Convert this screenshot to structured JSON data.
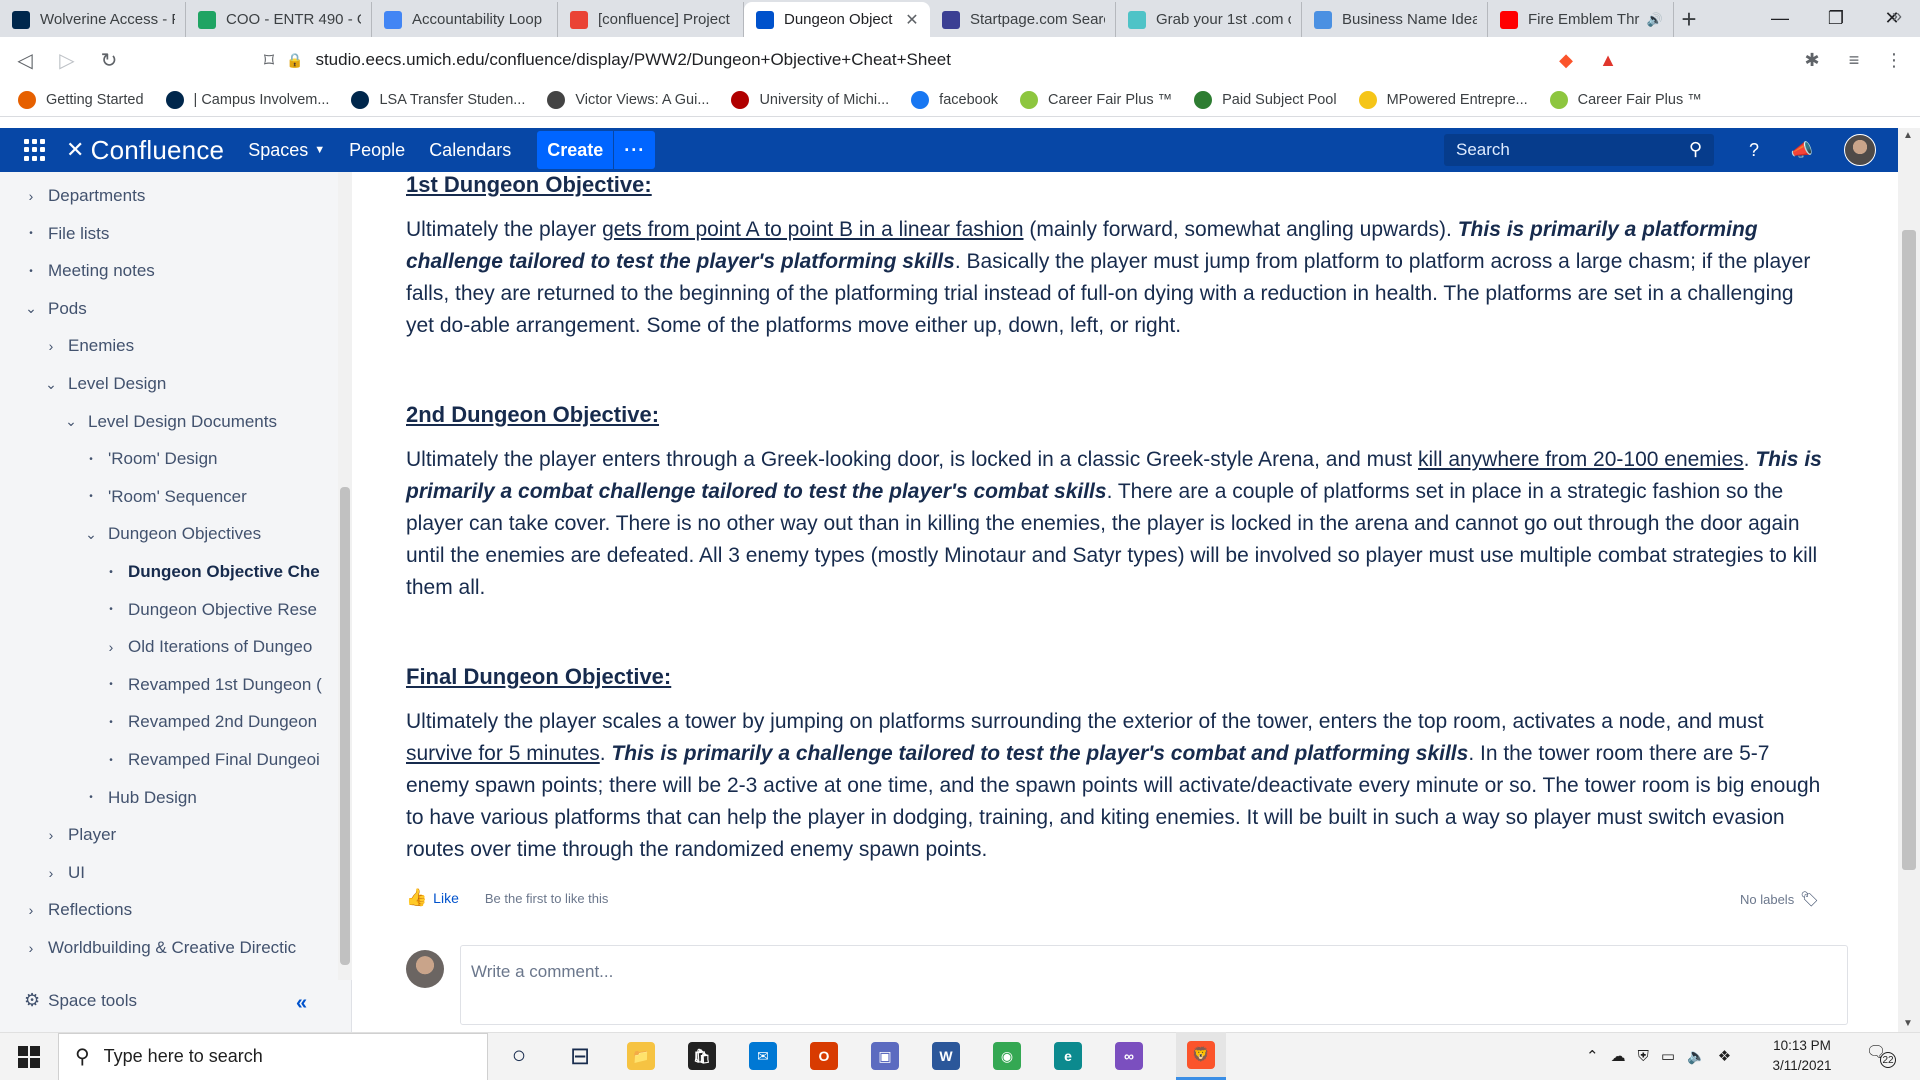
{
  "browser": {
    "tabs": [
      {
        "label": "Wolverine Access - F",
        "icon": "umich-block-m-icon",
        "color": "#00274c"
      },
      {
        "label": "COO - ENTR 490 - G",
        "icon": "google-drive-icon",
        "color": "#1fa463"
      },
      {
        "label": "Accountability Loop",
        "icon": "google-docs-icon",
        "color": "#4285f4"
      },
      {
        "label": "[confluence] Project",
        "icon": "gmail-icon",
        "color": "#ea4335"
      },
      {
        "label": "Dungeon Object",
        "icon": "confluence-icon",
        "color": "#0052cc",
        "active": true
      },
      {
        "label": "Startpage.com Searc",
        "icon": "startpage-icon",
        "color": "#3b3f93"
      },
      {
        "label": "Grab your 1st .com c",
        "icon": "domain-icon",
        "color": "#4fc3c7"
      },
      {
        "label": "Business Name Ideas",
        "icon": "bng-icon",
        "color": "#4a90e2"
      },
      {
        "label": "Fire Emblem Thr",
        "icon": "youtube-icon",
        "color": "#ff0000",
        "audio": true
      }
    ],
    "close_glyph": "✕",
    "new_tab_glyph": "+",
    "address": "studio.eecs.umich.edu/confluence/display/PWW2/Dungeon+Objective+Cheat+Sheet",
    "bookmarks": [
      {
        "label": "Getting Started",
        "icon": "firefox-icon",
        "color": "#e66000"
      },
      {
        "label": "| Campus Involvem...",
        "icon": "umich-block-m-icon",
        "color": "#00274c"
      },
      {
        "label": "LSA Transfer Studen...",
        "icon": "lsa-icon",
        "color": "#00274c"
      },
      {
        "label": "Victor Views: A Gui...",
        "icon": "globe-icon",
        "color": "#444444"
      },
      {
        "label": "University of Michi...",
        "icon": "umich-square-icon",
        "color": "#b00000"
      },
      {
        "label": "facebook",
        "icon": "facebook-icon",
        "color": "#1877f2"
      },
      {
        "label": "Career Fair Plus ™",
        "icon": "career-fair-icon",
        "color": "#8dc63f"
      },
      {
        "label": "Paid Subject Pool",
        "icon": "subject-pool-icon",
        "color": "#2e7d32"
      },
      {
        "label": "MPowered Entrepre...",
        "icon": "hexagon-icon",
        "color": "#f5c518"
      },
      {
        "label": "Career Fair Plus ™",
        "icon": "career-fair-icon",
        "color": "#8dc63f"
      }
    ]
  },
  "header": {
    "logo": "Confluence",
    "nav": {
      "spaces": "Spaces",
      "people": "People",
      "calendars": "Calendars"
    },
    "create": "Create",
    "more": "···",
    "search_placeholder": "Search",
    "colors": {
      "bar": "#0747a6",
      "button": "#0065ff"
    }
  },
  "sidebar": {
    "items": [
      {
        "label": "Departments",
        "marker": "›",
        "indent": 0
      },
      {
        "label": "File lists",
        "marker": "•",
        "indent": 0
      },
      {
        "label": "Meeting notes",
        "marker": "•",
        "indent": 0
      },
      {
        "label": "Pods",
        "marker": "⌄",
        "indent": 0
      },
      {
        "label": "Enemies",
        "marker": "›",
        "indent": 1
      },
      {
        "label": "Level Design",
        "marker": "⌄",
        "indent": 1
      },
      {
        "label": "Level Design Documents",
        "marker": "⌄",
        "indent": 2
      },
      {
        "label": "'Room' Design",
        "marker": "•",
        "indent": 3
      },
      {
        "label": "'Room' Sequencer",
        "marker": "•",
        "indent": 3
      },
      {
        "label": "Dungeon Objectives",
        "marker": "⌄",
        "indent": 3
      },
      {
        "label": "Dungeon Objective Che",
        "marker": "•",
        "indent": 4,
        "current": true
      },
      {
        "label": "Dungeon Objective Rese",
        "marker": "•",
        "indent": 4
      },
      {
        "label": "Old Iterations of Dungeo",
        "marker": "›",
        "indent": 4
      },
      {
        "label": "Revamped 1st Dungeon (",
        "marker": "•",
        "indent": 4
      },
      {
        "label": "Revamped 2nd Dungeon",
        "marker": "•",
        "indent": 4
      },
      {
        "label": "Revamped Final Dungeoi",
        "marker": "•",
        "indent": 4
      },
      {
        "label": "Hub Design",
        "marker": "•",
        "indent": 3
      },
      {
        "label": "Player",
        "marker": "›",
        "indent": 1
      },
      {
        "label": "UI",
        "marker": "›",
        "indent": 1
      },
      {
        "label": "Reflections",
        "marker": "›",
        "indent": 0
      },
      {
        "label": "Worldbuilding & Creative Directic",
        "marker": "›",
        "indent": 0
      }
    ],
    "space_tools": "Space tools",
    "collapse": "«"
  },
  "content": {
    "objectives": [
      {
        "heading": "1st Dungeon Objective:",
        "p1": "Ultimately the player ",
        "u1": "gets from point A to point B in a linear fashion",
        "p2": " (mainly forward, somewhat angling upwards). ",
        "bi": "This is primarily a platforming challenge tailored to test the player's platforming skills",
        "p3": ". Basically the player must jump from platform to platform across a large chasm; if the player falls, they are returned to the beginning of the platforming trial instead of full-on dying with a reduction in health. The platforms are set in a challenging yet do-able arrangement. Some of the platforms move either up, down, left, or right."
      },
      {
        "heading": "2nd Dungeon Objective:",
        "p1": "Ultimately the player enters through a Greek-looking door, is locked in a classic Greek-style Arena, and must ",
        "u1": "kill anywhere from 20-100 enemies",
        "p2": ". ",
        "bi": "This is primarily a combat challenge tailored to test the player's combat skills",
        "p3": ". There are a couple of platforms set in place in a strategic fashion so the player can take cover. There is no other way out than in killing the enemies, the player is locked in the arena and cannot go out through the door again until the enemies are defeated. All 3 enemy types (mostly Minotaur and Satyr types) will be involved so player must use multiple combat strategies to kill them all."
      },
      {
        "heading": "Final Dungeon Objective:",
        "p1": "Ultimately the player scales a tower by jumping on platforms surrounding the exterior of the tower, enters the top room, activates a node, and must ",
        "u1": "survive for 5 minutes",
        "p2": ". ",
        "bi": "This is primarily a challenge tailored to test the player's combat and platforming skills",
        "p3": ". In the tower room there are 5-7 enemy spawn points; there will be 2-3 active at one time, and the spawn points will activate/deactivate every minute or so. The tower room is big enough to have various platforms that can help the player in dodging, training, and kiting enemies. It will be built in such a way so player must switch evasion routes over time through the randomized enemy spawn points."
      }
    ],
    "like": "Like",
    "like_note": "Be the first to like this",
    "labels": "No labels",
    "comment_placeholder": "Write a comment..."
  },
  "taskbar": {
    "search_placeholder": "Type here to search",
    "time": "10:13 PM",
    "date": "3/11/2021",
    "notifications": "22",
    "apps": [
      {
        "name": "cortana-icon",
        "glyph": "○"
      },
      {
        "name": "task-view-icon",
        "glyph": "⊟"
      },
      {
        "name": "file-explorer-icon",
        "glyph": "📁"
      },
      {
        "name": "store-icon",
        "glyph": "🛍"
      },
      {
        "name": "mail-icon",
        "glyph": "✉"
      },
      {
        "name": "office-icon",
        "glyph": "O"
      },
      {
        "name": "media-app-icon",
        "glyph": "▣"
      },
      {
        "name": "word-icon",
        "glyph": "W"
      },
      {
        "name": "chrome-icon",
        "glyph": "◉"
      },
      {
        "name": "edge-icon",
        "glyph": "e"
      },
      {
        "name": "visual-studio-icon",
        "glyph": "∞"
      },
      {
        "name": "brave-icon",
        "glyph": "🦁"
      }
    ]
  }
}
